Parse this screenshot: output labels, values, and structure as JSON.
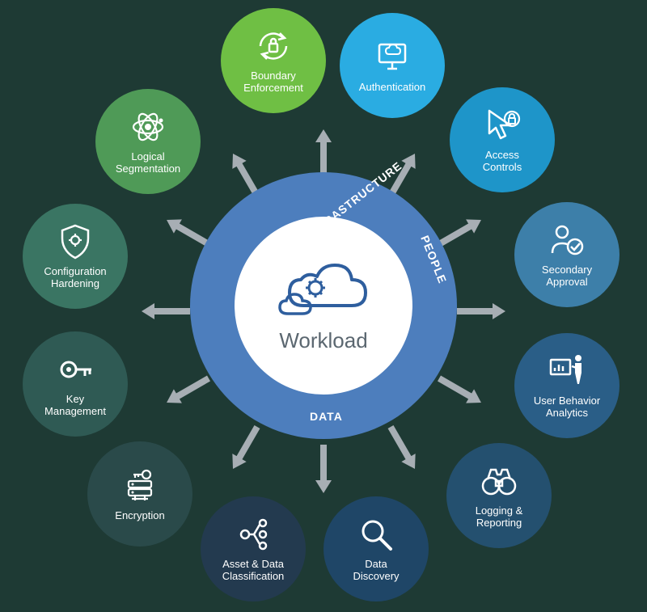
{
  "center": {
    "label": "Workload",
    "ring_labels": {
      "infrastructure": "INFRASTRUCTURE",
      "people": "PEOPLE",
      "data": "DATA"
    }
  },
  "nodes": [
    {
      "id": "boundary-enforcement",
      "label": "Boundary\nEnforcement",
      "color": "#6fbf44",
      "icon": "cycle-lock"
    },
    {
      "id": "authentication",
      "label": "Authentication",
      "color": "#2aace2",
      "icon": "monitor-cloud"
    },
    {
      "id": "access-controls",
      "label": "Access\nControls",
      "color": "#1e95c9",
      "icon": "cursor-lock"
    },
    {
      "id": "secondary-approval",
      "label": "Secondary\nApproval",
      "color": "#3d7fa9",
      "icon": "person-check"
    },
    {
      "id": "user-behavior",
      "label": "User Behavior\nAnalytics",
      "color": "#2a5e87",
      "icon": "presenter"
    },
    {
      "id": "logging-reporting",
      "label": "Logging &\nReporting",
      "color": "#24506f",
      "icon": "binoculars"
    },
    {
      "id": "data-discovery",
      "label": "Data\nDiscovery",
      "color": "#1f4667",
      "icon": "magnifier"
    },
    {
      "id": "asset-data-class",
      "label": "Asset & Data\nClassification",
      "color": "#233a4f",
      "icon": "tree-nodes"
    },
    {
      "id": "encryption",
      "label": "Encryption",
      "color": "#2a4a4a",
      "icon": "server-key"
    },
    {
      "id": "key-management",
      "label": "Key\nManagement",
      "color": "#2f5a54",
      "icon": "key"
    },
    {
      "id": "config-hardening",
      "label": "Configuration\nHardening",
      "color": "#3a7563",
      "icon": "shield-gear"
    },
    {
      "id": "logical-segmentation",
      "label": "Logical\nSegmentation",
      "color": "#4f9a57",
      "icon": "atom"
    }
  ]
}
